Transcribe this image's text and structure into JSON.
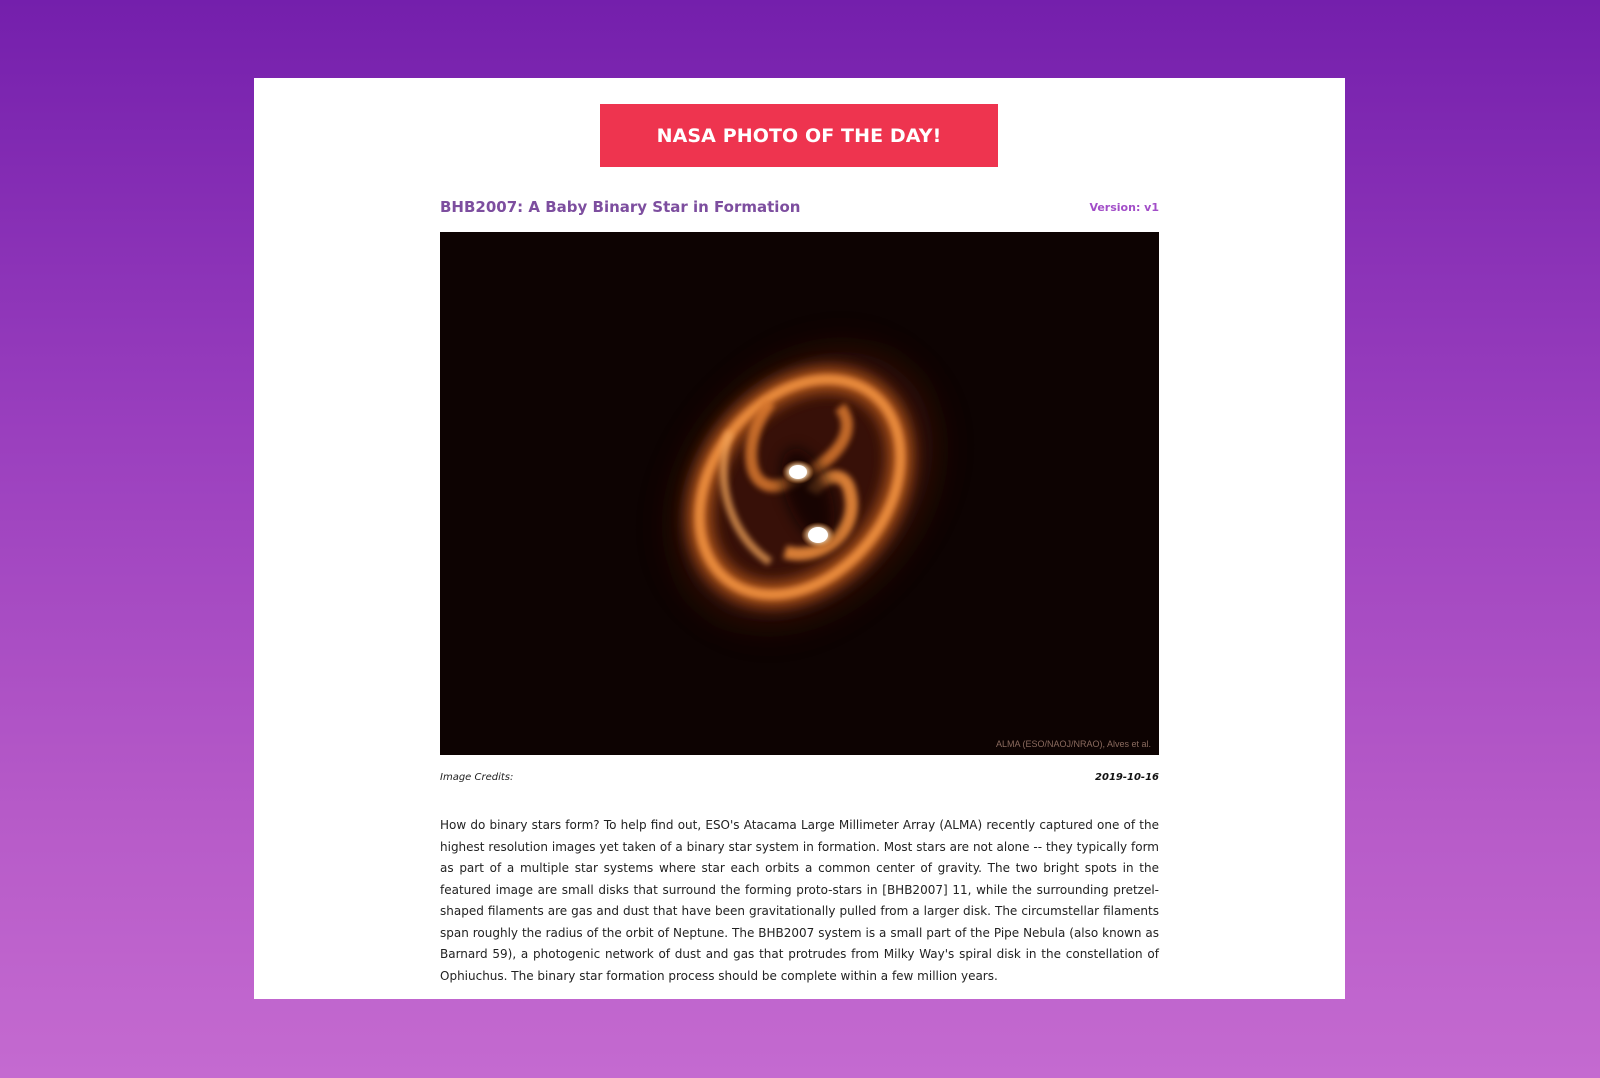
{
  "banner": {
    "label": "NASA PHOTO OF THE DAY!"
  },
  "photo": {
    "title": "BHB2007: A Baby Binary Star in Formation",
    "version": "Version: v1",
    "watermark": "ALMA (ESO/NAOJ/NRAO), Alves et al.",
    "credits_label": "Image Credits:",
    "date": "2019-10-16",
    "description": "How do binary stars form? To help find out, ESO's Atacama Large Millimeter Array (ALMA) recently captured one of the highest resolution images yet taken of a binary star system in formation. Most stars are not alone -- they typically form as part of a multiple star systems where star each orbits a common center of gravity. The two bright spots in the featured image are small disks that surround the forming proto-stars in [BHB2007] 11, while the surrounding pretzel-shaped filaments are gas and dust that have been gravitationally pulled from a larger disk. The circumstellar filaments span roughly the radius of the orbit of Neptune. The BHB2007 system is a small part of the Pipe Nebula (also known as Barnard 59), a photogenic network of dust and gas that protrudes from Milky Way's spiral disk in the constellation of Ophiuchus. The binary star formation process should be complete within a few million years."
  },
  "colors": {
    "background_top": "#741fac",
    "background_bottom": "#c46ad0",
    "banner": "#ee344f",
    "title": "#7d4e9f",
    "version": "#a24ec8"
  }
}
